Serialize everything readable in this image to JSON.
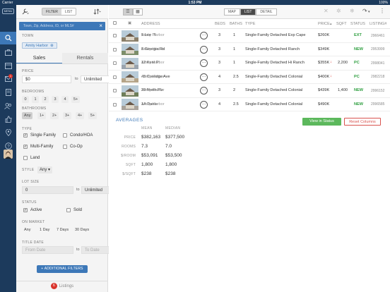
{
  "status_bar": {
    "carrier": "Carrier",
    "time": "1:53 PM",
    "battery": "100%"
  },
  "rail": {
    "menu_label": "MENU",
    "notification_count": "1"
  },
  "filter_panel": {
    "view_toggle": [
      "FILTER",
      "LIST"
    ],
    "search_placeholder": "Town, Zip, Address, ID, or MLS#",
    "town_label": "TOWN",
    "town_chip": "Amity Harbor",
    "tabs": [
      "Sales",
      "Rentals"
    ],
    "price_label": "PRICE",
    "price_min": "$0",
    "to": "to",
    "price_max": "Unlimited",
    "bedrooms_label": "BEDROOMS",
    "bedrooms": [
      "0",
      "1",
      "2",
      "3",
      "4",
      "5+"
    ],
    "bathrooms_label": "BATHROOMS",
    "bathrooms": [
      "Any",
      "1+",
      "2+",
      "3+",
      "4+",
      "5+"
    ],
    "type_label": "TYPE",
    "types": [
      {
        "label": "Single Family",
        "checked": true
      },
      {
        "label": "Condo/HOA",
        "checked": false
      },
      {
        "label": "Multi-Family",
        "checked": true
      },
      {
        "label": "Co-Op",
        "checked": false
      },
      {
        "label": "Land",
        "checked": false
      }
    ],
    "style_label": "STYLE",
    "style_value": "Any",
    "lot_label": "LOT SIZE",
    "lot_min": "0",
    "lot_max": "Unlimited",
    "status_label": "STATUS",
    "statuses": [
      {
        "label": "Active",
        "checked": true
      },
      {
        "label": "Sold",
        "checked": false
      }
    ],
    "market_label": "ON MARKET",
    "market_options": [
      "Any",
      "1 Day",
      "7 Days",
      "30 Days"
    ],
    "title_date_label": "TITLE DATE",
    "from_date_placeholder": "From Date",
    "to_date_placeholder": "To Date",
    "additional_filters": "+ ADDITIONAL FILTERS",
    "listings_count": "6",
    "listings_label": "Listings"
  },
  "main": {
    "view_segments": [
      "MAP",
      "LIST",
      "DETAIL"
    ],
    "columns": {
      "address": "ADDRESS",
      "beds": "BEDS",
      "baths": "BATHS",
      "type": "TYPE",
      "price": "PRICE",
      "sqft": "SQFT",
      "status": "STATUS",
      "listing": "LISTING#"
    },
    "rows": [
      {
        "street": "9 Lee Pl",
        "city": "Amity Harbor",
        "beds": "3",
        "baths": "1",
        "type": "Single-Family Detached Exp Cape",
        "price": "$260K",
        "sqft": "",
        "status": "EXT",
        "listing": "2966461",
        "photo": "#8a7f6a"
      },
      {
        "street": "8 Georgia Rd",
        "city": "Amity Harbor",
        "beds": "3",
        "baths": "1",
        "type": "Single-Family Detached Ranch",
        "price": "$349K",
        "sqft": "",
        "status": "NEW",
        "listing": "2953999",
        "photo": "#7c8e6a"
      },
      {
        "street": "12 Kent Pl",
        "city": "Amity Harbor",
        "beds": "3",
        "baths": "1",
        "type": "Single-Family Detached Hi Ranch",
        "price": "$355K",
        "sqft": "2,200",
        "status": "PC",
        "listing": "2998041",
        "photo": "#9aa4ae"
      },
      {
        "street": "45 Coolidge Ave",
        "city": "Amity Harbor",
        "beds": "4",
        "baths": "2.5",
        "type": "Single-Family Detached Colonial",
        "price": "$400K",
        "sqft": "",
        "status": "PC",
        "listing": "2982218",
        "photo": "#b5a488"
      },
      {
        "street": "29 North Plz",
        "city": "Amity Harbor",
        "beds": "3",
        "baths": "2",
        "type": "Single-Family Detached Colonial",
        "price": "$439K",
        "sqft": "1,400",
        "status": "NEW",
        "listing": "2996152",
        "photo": "#6f7e5a"
      },
      {
        "street": "1A Dante",
        "city": "Amity Harbor",
        "beds": "4",
        "baths": "2.5",
        "type": "Single-Family Detached Colonial",
        "price": "$490K",
        "sqft": "",
        "status": "NEW",
        "listing": "2996585",
        "photo": "#a8a29a"
      }
    ],
    "averages": {
      "title": "AVERAGES",
      "view_in_status": "View in Status",
      "reset_columns": "Reset Columns",
      "headers": [
        "MEAN",
        "MEDIAN"
      ],
      "rows": [
        {
          "label": "PRICE",
          "mean": "$382,163",
          "median": "$377,500"
        },
        {
          "label": "ROOMS",
          "mean": "7.3",
          "median": "7.0"
        },
        {
          "label": "$/ROOM",
          "mean": "$53,091",
          "median": "$53,500"
        },
        {
          "label": "SQFT",
          "mean": "1,800",
          "median": "1,800"
        },
        {
          "label": "$/SQFT",
          "mean": "$238",
          "median": "$238"
        }
      ]
    }
  },
  "colors": {
    "nav_dark": "#1c3a5c",
    "accent_blue": "#3d78b8",
    "status_green": "#2e9e3f",
    "reset_red": "#d9534f"
  }
}
